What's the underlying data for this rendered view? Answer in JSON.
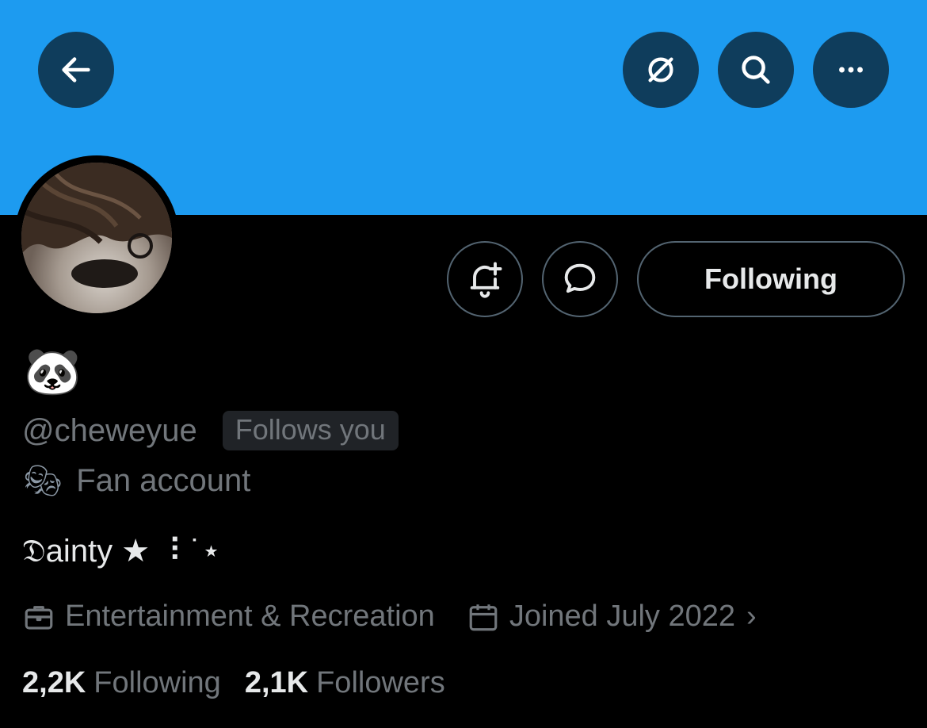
{
  "header": {
    "back_icon": "arrow-left-icon",
    "grok_icon": "grok-icon",
    "search_icon": "search-icon",
    "more_icon": "more-horizontal-icon",
    "banner_color": "#1d9bf0"
  },
  "actions": {
    "notify_icon": "bell-plus-icon",
    "message_icon": "message-bubble-icon",
    "following_label": "Following"
  },
  "profile": {
    "display_name": "🐼",
    "handle": "@cheweyue",
    "follows_you": "Follows you",
    "category_icon": "mask-icon",
    "category": "Fan account",
    "bio": "𝔇ainty ★ ⠸ ˙⋆",
    "professional_category": "Entertainment & Recreation",
    "joined": "Joined July 2022"
  },
  "stats": {
    "following_count": "2,2K",
    "following_label": "Following",
    "followers_count": "2,1K",
    "followers_label": "Followers"
  },
  "colors": {
    "text_primary": "#e7e9ea",
    "text_secondary": "#71767b",
    "button_border": "#536471"
  }
}
